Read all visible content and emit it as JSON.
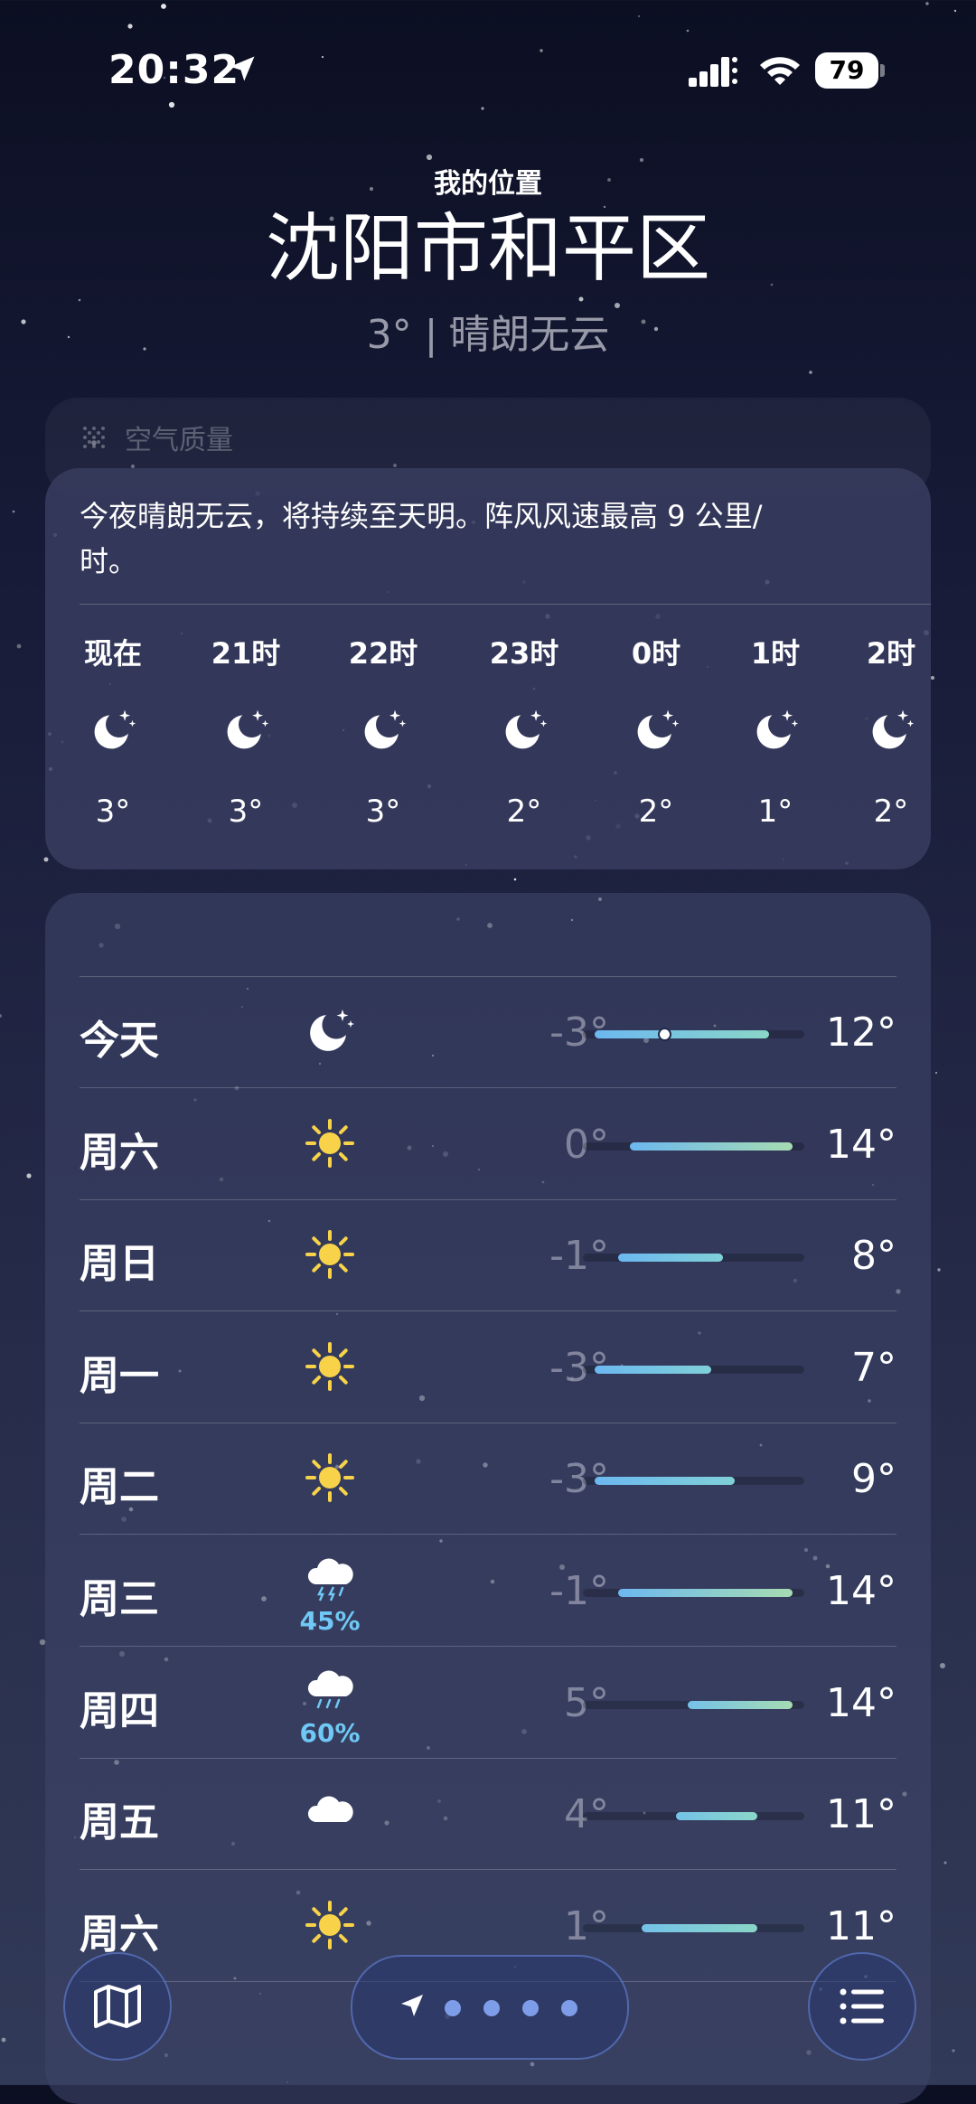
{
  "status_bar": {
    "time": "20:32",
    "battery": "79"
  },
  "header": {
    "subtitle": "我的位置",
    "city": "沈阳市和平区",
    "condition": "3° | 晴朗无云"
  },
  "air_quality": {
    "label": "空气质量"
  },
  "hourly": {
    "summary": "今夜晴朗无云，将持续至天明。阵风风速最高 9 公里/时。",
    "items": [
      {
        "label": "现在",
        "icon": "moon-stars-icon",
        "temp": "3°"
      },
      {
        "label": "21时",
        "icon": "moon-stars-icon",
        "temp": "3°"
      },
      {
        "label": "22时",
        "icon": "moon-stars-icon",
        "temp": "3°"
      },
      {
        "label": "23时",
        "icon": "moon-stars-icon",
        "temp": "2°"
      },
      {
        "label": "0时",
        "icon": "moon-stars-icon",
        "temp": "2°"
      },
      {
        "label": "1时",
        "icon": "moon-stars-icon",
        "temp": "1°"
      },
      {
        "label": "2时",
        "icon": "moon-stars-icon",
        "temp": "2°"
      }
    ]
  },
  "daily": {
    "scale_min": -4,
    "scale_max": 15,
    "current_temp": 3,
    "items": [
      {
        "day": "今天",
        "icon": "moon-stars-icon",
        "precip": "",
        "low": "-3°",
        "high": "12°",
        "low_val": -3,
        "high_val": 12
      },
      {
        "day": "周六",
        "icon": "sun-icon",
        "precip": "",
        "low": "0°",
        "high": "14°",
        "low_val": 0,
        "high_val": 14
      },
      {
        "day": "周日",
        "icon": "sun-icon",
        "precip": "",
        "low": "-1°",
        "high": "8°",
        "low_val": -1,
        "high_val": 8
      },
      {
        "day": "周一",
        "icon": "sun-icon",
        "precip": "",
        "low": "-3°",
        "high": "7°",
        "low_val": -3,
        "high_val": 7
      },
      {
        "day": "周二",
        "icon": "sun-icon",
        "precip": "",
        "low": "-3°",
        "high": "9°",
        "low_val": -3,
        "high_val": 9
      },
      {
        "day": "周三",
        "icon": "thunderstorm-icon",
        "precip": "45%",
        "low": "-1°",
        "high": "14°",
        "low_val": -1,
        "high_val": 14
      },
      {
        "day": "周四",
        "icon": "rain-icon",
        "precip": "60%",
        "low": "5°",
        "high": "14°",
        "low_val": 5,
        "high_val": 14
      },
      {
        "day": "周五",
        "icon": "cloud-icon",
        "precip": "",
        "low": "4°",
        "high": "11°",
        "low_val": 4,
        "high_val": 11
      },
      {
        "day": "周六",
        "icon": "sun-icon",
        "precip": "",
        "low": "1°",
        "high": "11°",
        "low_val": 1,
        "high_val": 11
      }
    ]
  },
  "toolbar": {
    "map_icon": "map-icon",
    "location_icon": "location-arrow-icon",
    "list_icon": "list-icon",
    "page_count": 4
  }
}
